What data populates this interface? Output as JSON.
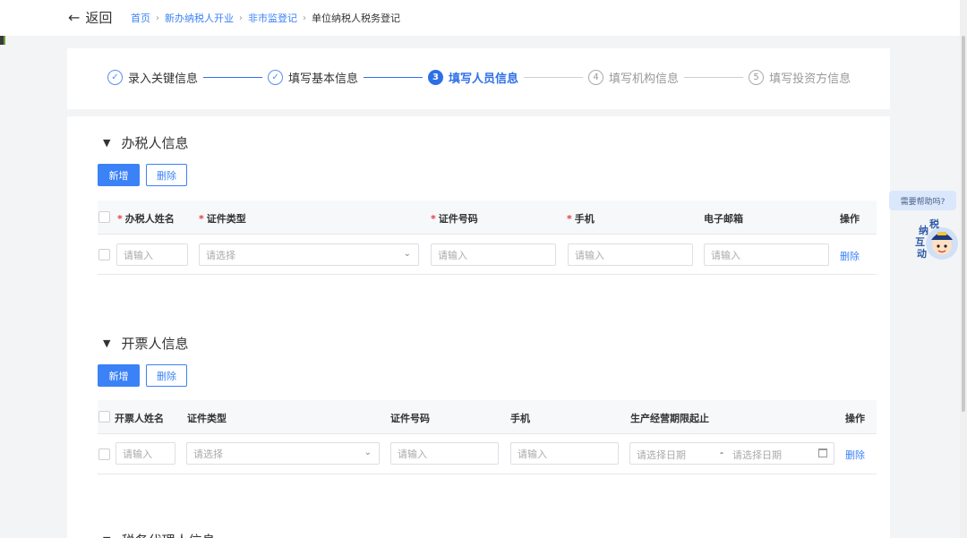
{
  "header": {
    "back_label": "返回",
    "breadcrumb": [
      "首页",
      "新办纳税人开业",
      "非市监登记",
      "单位纳税人税务登记"
    ]
  },
  "steps": [
    {
      "num": "✓",
      "label": "录入关键信息",
      "state": "done"
    },
    {
      "num": "✓",
      "label": "填写基本信息",
      "state": "done"
    },
    {
      "num": "3",
      "label": "填写人员信息",
      "state": "active"
    },
    {
      "num": "4",
      "label": "填写机构信息",
      "state": "pending"
    },
    {
      "num": "5",
      "label": "填写投资方信息",
      "state": "pending"
    }
  ],
  "tax_handler": {
    "title": "办税人信息",
    "add_label": "新增",
    "delete_label": "删除",
    "columns": [
      "办税人姓名",
      "证件类型",
      "证件号码",
      "手机",
      "电子邮箱",
      "操作"
    ],
    "row": {
      "name_placeholder": "请输入",
      "id_type_placeholder": "请选择",
      "id_number_placeholder": "请输入",
      "phone_placeholder": "请输入",
      "email_placeholder": "请输入",
      "delete_label": "删除"
    }
  },
  "invoice_issuer": {
    "title": "开票人信息",
    "add_label": "新增",
    "delete_label": "删除",
    "columns": [
      "开票人姓名",
      "证件类型",
      "证件号码",
      "手机",
      "生产经营期限起止",
      "操作"
    ],
    "row": {
      "name_placeholder": "请输入",
      "id_type_placeholder": "请选择",
      "id_number_placeholder": "请输入",
      "phone_placeholder": "请输入",
      "start_date_placeholder": "请选择日期",
      "date_separator": "-",
      "end_date_placeholder": "请选择日期",
      "delete_label": "删除"
    }
  },
  "next_section": {
    "title": "税务代理人信息"
  },
  "help": {
    "bubble": "需要帮助吗?",
    "mascot_chars": [
      "纳",
      "税",
      "互",
      "动"
    ]
  },
  "colors": {
    "primary": "#3b82f6",
    "required": "#e53e3e"
  }
}
